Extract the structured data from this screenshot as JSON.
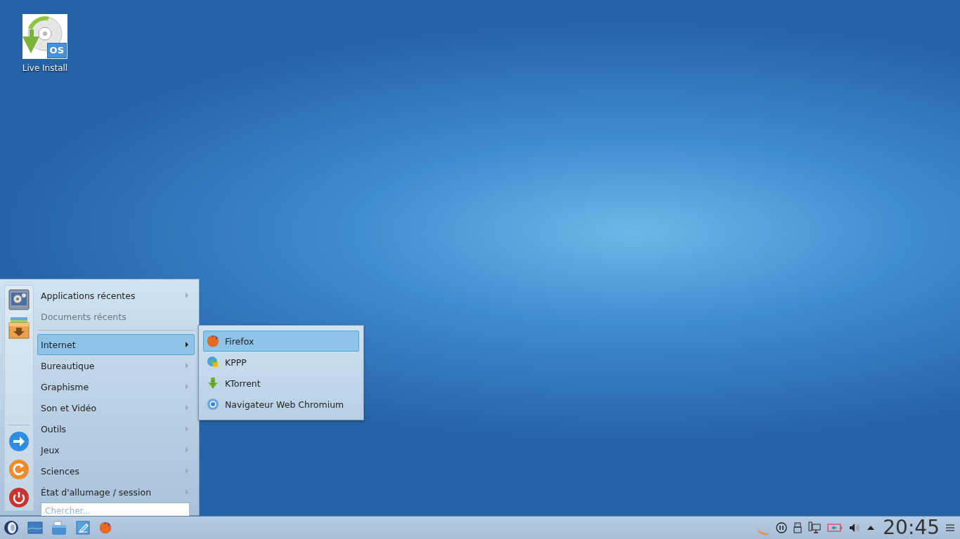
{
  "desktop_icons": [
    {
      "label": "Live Install",
      "badge": "OS"
    }
  ],
  "menu": {
    "favorites": [
      {
        "kind": "settings"
      },
      {
        "kind": "installer"
      }
    ],
    "session_actions": [
      {
        "kind": "switch"
      },
      {
        "kind": "restart"
      },
      {
        "kind": "power"
      }
    ],
    "items": [
      {
        "label": "Applications récentes",
        "submenu": true,
        "disabled": false,
        "selected": false
      },
      {
        "label": "Documents récents",
        "submenu": false,
        "disabled": true,
        "selected": false
      },
      {
        "kind": "separator"
      },
      {
        "label": "Internet",
        "submenu": true,
        "disabled": false,
        "selected": true
      },
      {
        "label": "Bureautique",
        "submenu": true,
        "disabled": false,
        "selected": false
      },
      {
        "label": "Graphisme",
        "submenu": true,
        "disabled": false,
        "selected": false
      },
      {
        "label": "Son et Vidéo",
        "submenu": true,
        "disabled": false,
        "selected": false
      },
      {
        "label": "Outils",
        "submenu": true,
        "disabled": false,
        "selected": false
      },
      {
        "label": "Jeux",
        "submenu": true,
        "disabled": false,
        "selected": false
      },
      {
        "label": "Sciences",
        "submenu": true,
        "disabled": false,
        "selected": false
      },
      {
        "label": "État d'allumage / session",
        "submenu": true,
        "disabled": false,
        "selected": false
      }
    ],
    "search": {
      "placeholder": "Chercher..."
    }
  },
  "submenu": {
    "items": [
      {
        "label": "Firefox",
        "kind": "firefox",
        "selected": true
      },
      {
        "label": "KPPP",
        "kind": "globe",
        "selected": false
      },
      {
        "label": "KTorrent",
        "kind": "torrent",
        "selected": false
      },
      {
        "label": "Navigateur Web Chromium",
        "kind": "chromium",
        "selected": false
      }
    ]
  },
  "taskbar": {
    "launchers": [
      {
        "kind": "start"
      },
      {
        "kind": "desktop"
      },
      {
        "kind": "files"
      },
      {
        "kind": "editor"
      },
      {
        "kind": "firefox"
      }
    ],
    "tray": [
      {
        "kind": "clementine"
      },
      {
        "kind": "pause"
      },
      {
        "kind": "usb"
      },
      {
        "kind": "network"
      },
      {
        "kind": "battery"
      },
      {
        "kind": "volume"
      },
      {
        "kind": "expand"
      }
    ],
    "clock": "20:45"
  }
}
